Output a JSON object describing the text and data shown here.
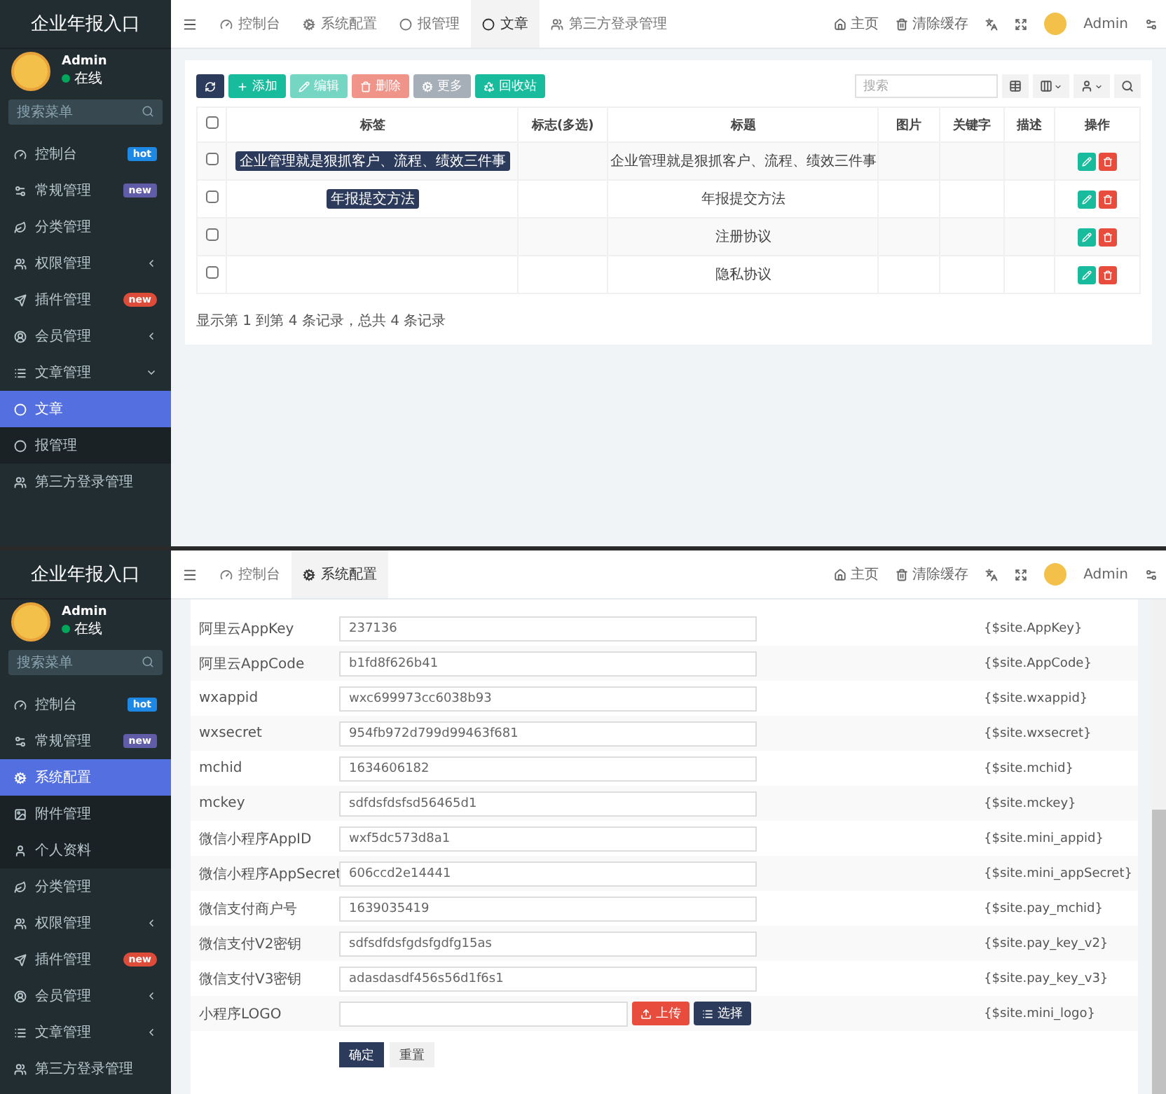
{
  "screens": [
    {
      "kind": "list",
      "brand": "企业年报入口",
      "user": {
        "name": "Admin",
        "status": "在线"
      },
      "menu_search": {
        "placeholder": "搜索菜单"
      },
      "sidebar": {
        "items": [
          {
            "label": "控制台",
            "badge": {
              "text": "hot",
              "color": "#1e88e5"
            }
          },
          {
            "label": "常规管理",
            "badge": {
              "text": "new",
              "color": "#605ca8"
            }
          },
          {
            "label": "分类管理"
          },
          {
            "label": "权限管理",
            "expanded": false
          },
          {
            "label": "插件管理",
            "badge": {
              "text": "new",
              "color": "#dd4b39"
            }
          },
          {
            "label": "会员管理",
            "expanded": false
          },
          {
            "label": "文章管理",
            "expanded": true,
            "children": [
              {
                "label": "文章",
                "selected": true
              },
              {
                "label": "报管理",
                "selected": false
              }
            ]
          },
          {
            "label": "第三方登录管理"
          }
        ]
      },
      "tabs": [
        {
          "label": "控制台",
          "selected": false
        },
        {
          "label": "系统配置",
          "selected": false
        },
        {
          "label": "报管理",
          "selected": false
        },
        {
          "label": "文章",
          "selected": true
        },
        {
          "label": "第三方登录管理",
          "selected": false
        }
      ],
      "header_links": [
        "主页",
        "清除缓存"
      ],
      "header_user": "Admin",
      "toolbar": [
        {
          "kind": "refresh",
          "disabled": false
        },
        {
          "kind": "add",
          "label": "添加",
          "disabled": false
        },
        {
          "kind": "edit",
          "label": "编辑",
          "disabled": true
        },
        {
          "kind": "delete",
          "label": "删除",
          "disabled": true
        },
        {
          "kind": "more",
          "label": "更多",
          "disabled": true
        },
        {
          "kind": "recycle",
          "label": "回收站",
          "disabled": false
        }
      ],
      "search": {
        "placeholder": "搜索"
      },
      "table": {
        "header_checked": false,
        "columns": [
          "标签",
          "标志(多选)",
          "标题",
          "图片",
          "关键字",
          "描述",
          "操作"
        ],
        "rows": [
          {
            "checked": false,
            "tag": "企业管理就是狠抓客户、流程、绩效三件事",
            "title": "企业管理就是狠抓客户、流程、绩效三件事"
          },
          {
            "checked": false,
            "tag": "年报提交方法",
            "title": "年报提交方法"
          },
          {
            "checked": false,
            "title": "注册协议"
          },
          {
            "checked": false,
            "title": "隐私协议"
          }
        ]
      },
      "footer": "显示第 1 到第 4 条记录，总共 4 条记录"
    },
    {
      "kind": "form",
      "brand": "企业年报入口",
      "user": {
        "name": "Admin",
        "status": "在线"
      },
      "menu_search": {
        "placeholder": "搜索菜单"
      },
      "sidebar": {
        "items": [
          {
            "label": "控制台",
            "badge": {
              "text": "hot",
              "color": "#1e88e5"
            }
          },
          {
            "label": "常规管理",
            "badge": {
              "text": "new",
              "color": "#605ca8"
            },
            "children": [
              {
                "label": "系统配置",
                "selected": true
              },
              {
                "label": "附件管理",
                "selected": false
              },
              {
                "label": "个人资料",
                "selected": false
              }
            ]
          },
          {
            "label": "分类管理"
          },
          {
            "label": "权限管理",
            "expanded": false
          },
          {
            "label": "插件管理",
            "badge": {
              "text": "new",
              "color": "#dd4b39"
            }
          },
          {
            "label": "会员管理",
            "expanded": false
          },
          {
            "label": "文章管理",
            "expanded": false
          },
          {
            "label": "第三方登录管理"
          }
        ]
      },
      "tabs": [
        {
          "label": "控制台",
          "selected": false
        },
        {
          "label": "系统配置",
          "selected": true
        }
      ],
      "header_links": [
        "主页",
        "清除缓存"
      ],
      "header_user": "Admin",
      "form_rows": [
        {
          "kind": "text",
          "label": "阿里云AppKey",
          "value": "237136",
          "variable": "{$site.AppKey}"
        },
        {
          "kind": "text",
          "label": "阿里云AppCode",
          "value": "b1fd8f626b41",
          "variable": "{$site.AppCode}"
        },
        {
          "kind": "text",
          "label": "wxappid",
          "value": "wxc699973cc6038b93",
          "variable": "{$site.wxappid}"
        },
        {
          "kind": "text",
          "label": "wxsecret",
          "value": "954fb972d799d99463f681",
          "variable": "{$site.wxsecret}"
        },
        {
          "kind": "text",
          "label": "mchid",
          "value": "1634606182",
          "variable": "{$site.mchid}"
        },
        {
          "kind": "text",
          "label": "mckey",
          "value": "sdfdsfdsfsd56465d1",
          "variable": "{$site.mckey}"
        },
        {
          "kind": "text",
          "label": "微信小程序AppID",
          "value": "wxf5dc573d8a1",
          "variable": "{$site.mini_appid}"
        },
        {
          "kind": "text",
          "label": "微信小程序AppSecret",
          "value": "606ccd2e14441",
          "variable": "{$site.mini_appSecret}"
        },
        {
          "kind": "text",
          "label": "微信支付商户号",
          "value": "1639035419",
          "variable": "{$site.pay_mchid}"
        },
        {
          "kind": "text",
          "label": "微信支付V2密钥",
          "value": "sdfsdfdsfgdsfgdfg15as",
          "variable": "{$site.pay_key_v2}"
        },
        {
          "kind": "text",
          "label": "微信支付V3密钥",
          "value": "adasdasdf456s56d1f6s1",
          "variable": "{$site.pay_key_v3}"
        },
        {
          "kind": "image",
          "label": "小程序LOGO",
          "variable": "{$site.mini_logo}",
          "buttons": [
            {
              "kind": "upload",
              "label": "上传"
            },
            {
              "kind": "choose",
              "label": "选择"
            }
          ]
        }
      ],
      "actions": [
        {
          "kind": "primary",
          "label": "确定"
        },
        {
          "kind": "default",
          "label": "重置"
        }
      ]
    }
  ]
}
